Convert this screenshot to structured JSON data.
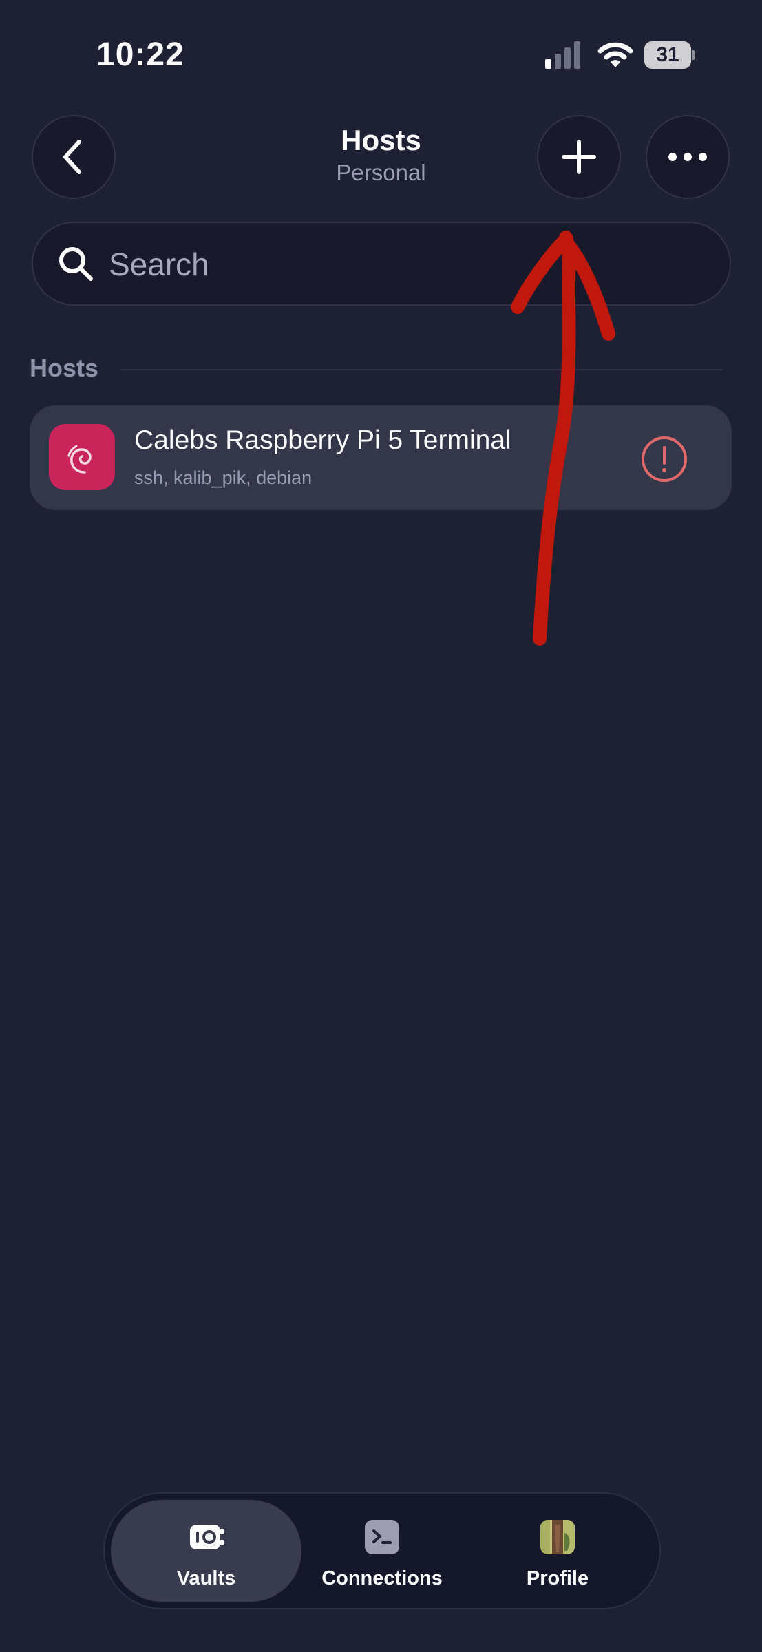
{
  "status_bar": {
    "time": "10:22",
    "battery": "31"
  },
  "header": {
    "title": "Hosts",
    "subtitle": "Personal",
    "back_icon": "chevron-left-icon",
    "add_icon": "plus-icon",
    "more_icon": "ellipsis-icon"
  },
  "search": {
    "placeholder": "Search",
    "value": ""
  },
  "section": {
    "label": "Hosts"
  },
  "hosts": [
    {
      "name": "Calebs Raspberry Pi 5 Terminal",
      "details": "ssh, kalib_pik, debian",
      "icon": "debian-icon",
      "status_icon": "warning-icon"
    }
  ],
  "tab_bar": {
    "items": [
      {
        "label": "Vaults",
        "icon": "vault-icon",
        "active": true
      },
      {
        "label": "Connections",
        "icon": "terminal-icon",
        "active": false
      },
      {
        "label": "Profile",
        "icon": "avatar-icon",
        "active": false
      }
    ]
  },
  "colors": {
    "background": "#1e2033",
    "host_icon": "#c9255b",
    "warning": "#e06a6a",
    "annotation": "#c0180c"
  }
}
